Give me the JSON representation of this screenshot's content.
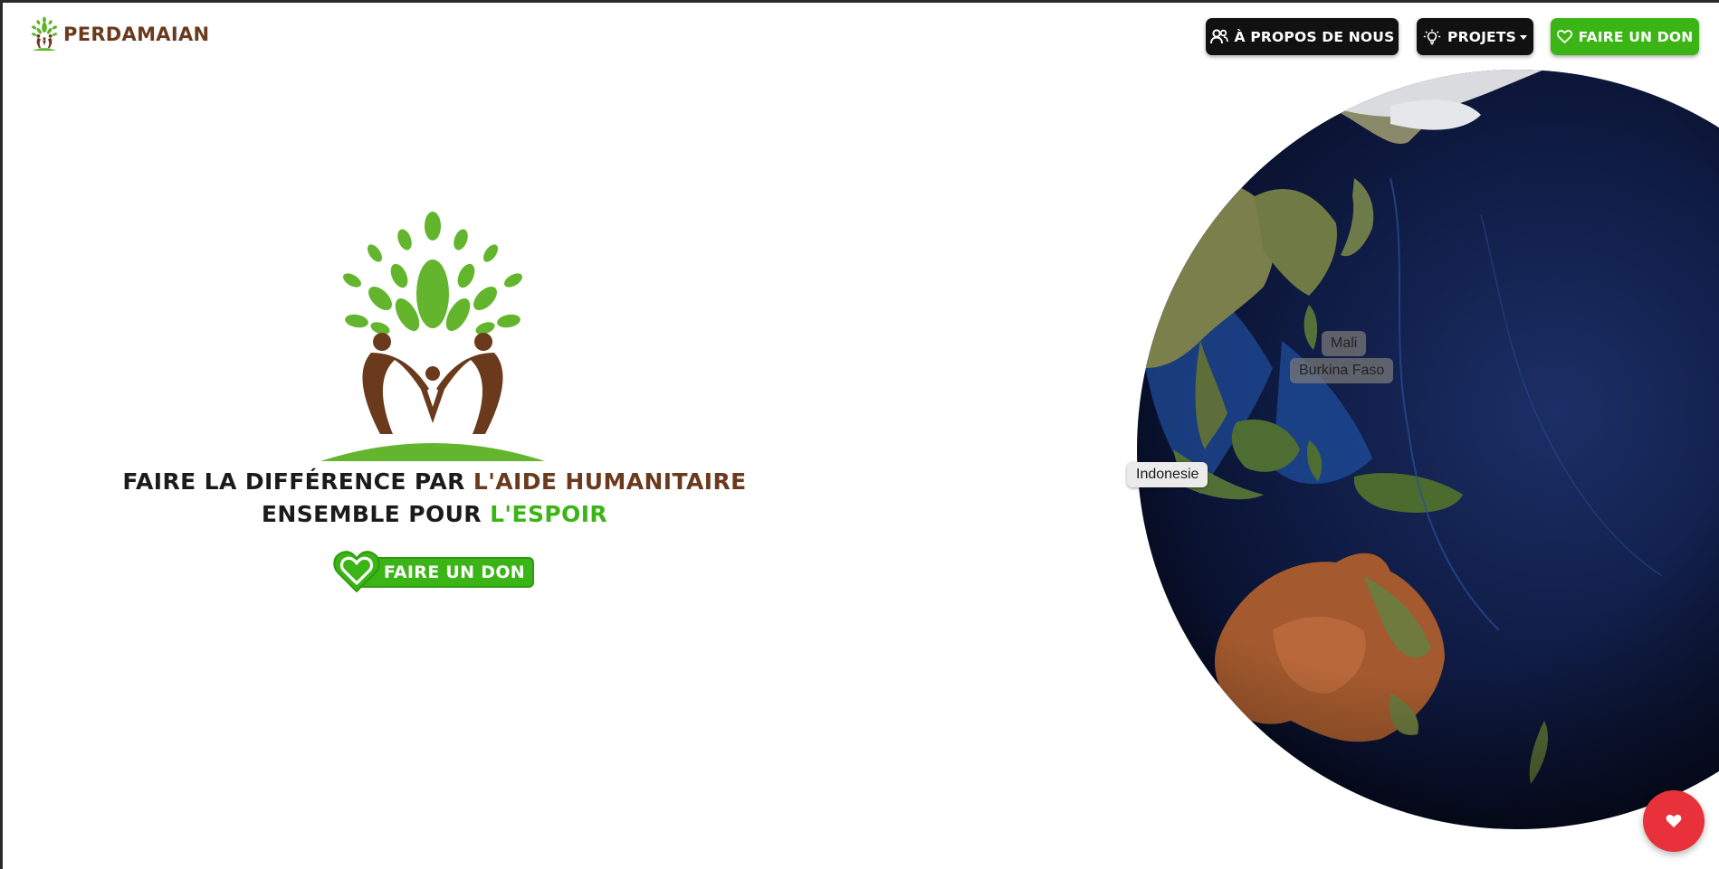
{
  "navbar": {
    "brand_name": "PERDAMAIAN",
    "about_label": "À PROPOS DE NOUS",
    "projects_label": "PROJETS",
    "donate_label": "FAIRE UN DON"
  },
  "hero": {
    "line1_part1": "FAIRE LA DIFFÉRENCE PAR ",
    "line1_part2": "L'AIDE HUMANITAIRE",
    "line2_part1": "ENSEMBLE POUR ",
    "line2_part2": "L'ESPOIR",
    "donate_label": "FAIRE UN DON"
  },
  "globe": {
    "labels": [
      "Mali",
      "Burkina Faso",
      "Indonesie"
    ],
    "highlighted_label": "Indonesie"
  },
  "colors": {
    "brand_brown": "#6b3a1c",
    "brand_green": "#3bb516",
    "nav_dark": "#111111",
    "fab_red": "#e8313a"
  },
  "icons": {
    "about": "users-icon",
    "projects": "lightbulb-icon",
    "donate": "heart-icon",
    "fab": "heart-icon"
  }
}
